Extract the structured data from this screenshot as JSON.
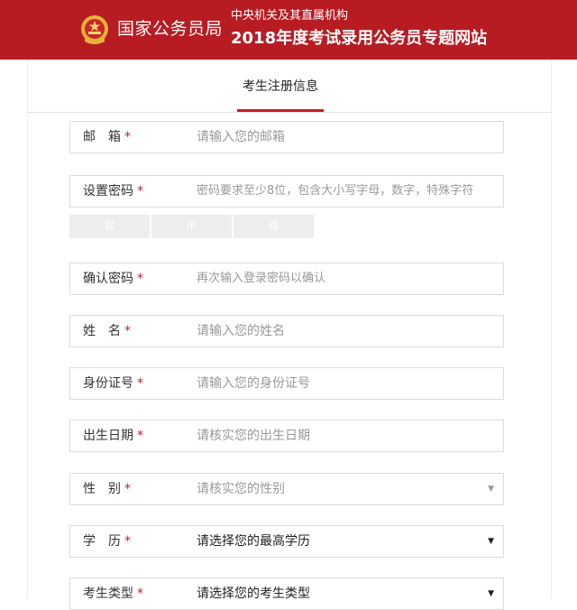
{
  "header": {
    "bureau_name": "国家公务员局",
    "subtitle_line1": "中央机关及其直属机构",
    "subtitle_line2": "2018年度考试录用公务员专题网站",
    "colors": {
      "banner_red": "#b71c23",
      "accent_red": "#c51d24"
    }
  },
  "tabs": [
    {
      "label": "考生注册信息",
      "active": true
    }
  ],
  "form": {
    "fields": [
      {
        "label": "邮　箱",
        "placeholder": "请输入您的邮箱",
        "required": true
      },
      {
        "label": "设置密码",
        "placeholder": "密码要求至少8位，包含大小写字母，数字，特殊字符",
        "required": true
      },
      {
        "label": "确认密码",
        "placeholder": "再次输入登录密码以确认",
        "required": true
      },
      {
        "label": "姓　名",
        "placeholder": "请输入您的姓名",
        "required": true
      },
      {
        "label": "身份证号",
        "placeholder": "请输入您的身份证号",
        "required": true
      },
      {
        "label": "出生日期",
        "placeholder": "请核实您的出生日期",
        "required": true
      },
      {
        "label": "性　别",
        "value": "请核实您的性别",
        "required": true,
        "type": "select",
        "disabled": true
      },
      {
        "label": "学　历",
        "value": "请选择您的最高学历",
        "required": true,
        "type": "select"
      },
      {
        "label": "考生类型",
        "value": "请选择您的考生类型",
        "required": true,
        "type": "select"
      }
    ],
    "required_mark": "*",
    "password_strength": [
      "弱",
      "中",
      "强"
    ],
    "select_caret": "▼"
  }
}
